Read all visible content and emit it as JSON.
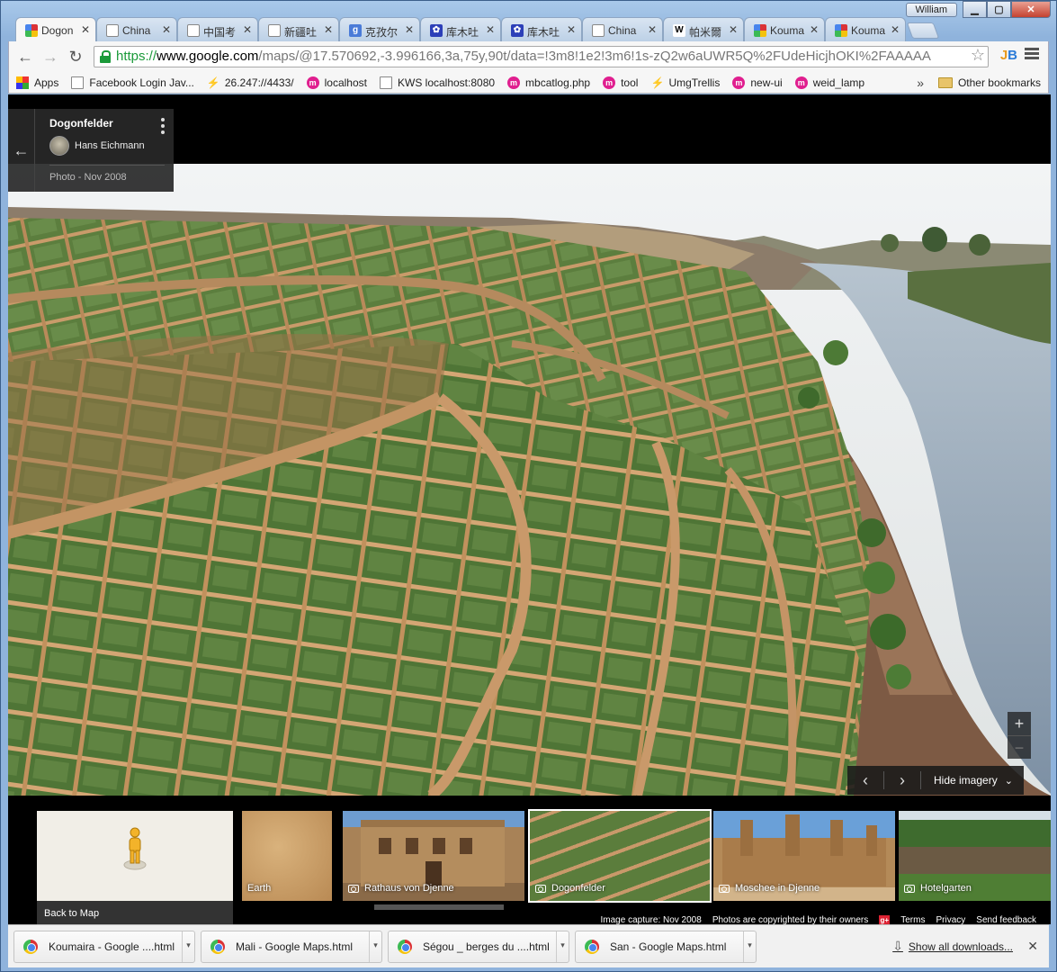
{
  "window": {
    "user": "William",
    "controls": {
      "minimize": "▁",
      "maximize": "▢",
      "close": "✕"
    }
  },
  "tabs": [
    {
      "label": "Dogon",
      "icon": "maps-icon",
      "color": "#3b8d3b",
      "active": true
    },
    {
      "label": "China",
      "icon": "page-icon",
      "color": "#ffffff"
    },
    {
      "label": "中国考",
      "icon": "page-icon",
      "color": "#ffffff"
    },
    {
      "label": "新疆吐",
      "icon": "page-icon",
      "color": "#ffffff"
    },
    {
      "label": "克孜尔",
      "icon": "google-icon",
      "color": "#4a7bd8"
    },
    {
      "label": "库木吐",
      "icon": "baidu-icon",
      "color": "#2c3fb8"
    },
    {
      "label": "库木吐",
      "icon": "baidu-icon",
      "color": "#2c3fb8"
    },
    {
      "label": "China",
      "icon": "page-icon",
      "color": "#ffffff"
    },
    {
      "label": "帕米爾",
      "icon": "wikipedia-icon",
      "color": "#ffffff"
    },
    {
      "label": "Kouma",
      "icon": "maps-icon",
      "color": "#3b8d3b"
    },
    {
      "label": "Kouma",
      "icon": "maps-icon",
      "color": "#3b8d3b"
    }
  ],
  "omnibox": {
    "scheme": "https://",
    "host": "www.google.com",
    "rest": "/maps/@17.570692,-3.996166,3a,75y,90t/data=!3m8!1e2!3m6!1s-zQ2w6aUWR5Q%2FUdeHicjhOKI%2FAAAAA"
  },
  "bookmarks": [
    {
      "label": "Apps",
      "icon": "apps-icon"
    },
    {
      "label": "Facebook Login Jav...",
      "icon": "page-icon"
    },
    {
      "label": "26.247://4433/",
      "icon": "jira-icon"
    },
    {
      "label": "localhost",
      "icon": "m-icon"
    },
    {
      "label": "KWS localhost:8080",
      "icon": "page-icon"
    },
    {
      "label": "mbcatlog.php",
      "icon": "m-icon"
    },
    {
      "label": "tool",
      "icon": "m-icon"
    },
    {
      "label": "UmgTrellis",
      "icon": "jira-icon"
    },
    {
      "label": "new-ui",
      "icon": "m-icon"
    },
    {
      "label": "weid_lamp",
      "icon": "m-icon"
    }
  ],
  "bookmarks_more": "»",
  "other_bookmarks": "Other bookmarks",
  "photo_card": {
    "title": "Dogonfelder",
    "author": "Hans Eichmann",
    "date": "Photo - Nov 2008"
  },
  "image_nav": {
    "hide_label": "Hide imagery"
  },
  "filmstrip": {
    "back_to_map": "Back to Map",
    "items": [
      {
        "label": "Earth",
        "camera": false
      },
      {
        "label": "Rathaus von Djenne",
        "camera": true
      },
      {
        "label": "Dogonfelder",
        "camera": true,
        "selected": true
      },
      {
        "label": "Moschee in Djenne",
        "camera": true
      },
      {
        "label": "Hotelgarten",
        "camera": true
      }
    ]
  },
  "footer": {
    "capture": "Image capture: Nov 2008",
    "copyright": "Photos are copyrighted by their owners",
    "terms": "Terms",
    "privacy": "Privacy",
    "feedback": "Send feedback"
  },
  "downloads": [
    {
      "label": "Koumaira - Google ....html"
    },
    {
      "label": "Mali - Google Maps.html"
    },
    {
      "label": "Ségou _ berges du ....html"
    },
    {
      "label": "San - Google Maps.html"
    }
  ],
  "show_all_downloads": "Show all downloads..."
}
